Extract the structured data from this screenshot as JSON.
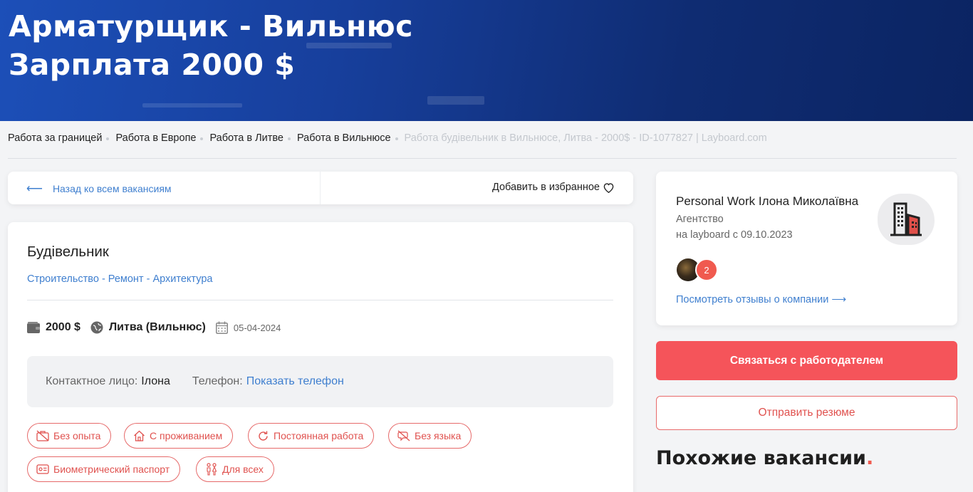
{
  "hero": {
    "title_line1": "Арматурщик - Вильнюс",
    "title_line2": "Зарплата 2000 $"
  },
  "breadcrumb": {
    "items": [
      "Работа за границей",
      "Работа в Европе",
      "Работа в Литве",
      "Работа в Вильнюсе"
    ],
    "current": "Работа будівельник в Вильнюсе, Литва - 2000$ - ID-1077827 | Layboard.com"
  },
  "backbar": {
    "back_label": "Назад ко всем вакансиям",
    "favorite_label": "Добавить в избранное"
  },
  "job": {
    "title": "Будівельник",
    "category": "Строительство - Ремонт - Архитектура",
    "salary": "2000 $",
    "location": "Литва (Вильнюс)",
    "date": "05-04-2024",
    "contact_label": "Контактное лицо:",
    "contact_value": "Ілона",
    "phone_label": "Телефон:",
    "phone_link": "Показать телефон",
    "tags": [
      "Без опыта",
      "С проживанием",
      "Постоянная работа",
      "Без языка",
      "Биометрический паспорт",
      "Для всех"
    ]
  },
  "company": {
    "name": "Personal Work Ілона Миколаївна",
    "type": "Агентство",
    "since": "на layboard с 09.10.2023",
    "reviews_count": "2",
    "reviews_link": "Посмотреть отзывы о компании ⟶"
  },
  "actions": {
    "contact_employer": "Связаться с работодателем",
    "send_resume": "Отправить резюме"
  },
  "similar": {
    "title": "Похожие вакансии",
    "dot": "."
  },
  "colors": {
    "hero_blue": "#1c4fb8",
    "link_blue": "#3f7fcf",
    "accent_red": "#f5545a"
  },
  "icons": [
    "back-arrow-icon",
    "heart-icon",
    "wallet-icon",
    "globe-icon",
    "calendar-icon",
    "building-icon"
  ]
}
